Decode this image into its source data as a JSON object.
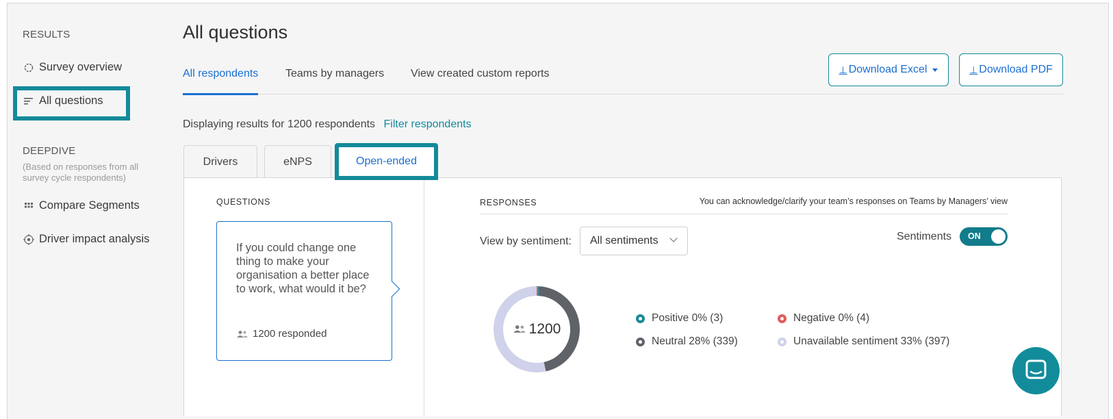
{
  "sidebar": {
    "results_heading": "RESULTS",
    "items": [
      {
        "label": "Survey overview",
        "icon": "circle-icon"
      },
      {
        "label": "All questions",
        "icon": "list-icon"
      }
    ],
    "deepdive_heading": "DEEPDIVE",
    "deepdive_note": "(Based on responses from all survey cycle respondents)",
    "deepdive_items": [
      {
        "label": "Compare Segments",
        "icon": "grid-icon"
      },
      {
        "label": "Driver impact analysis",
        "icon": "target-icon"
      }
    ]
  },
  "header": {
    "title": "All questions",
    "tabs": [
      {
        "label": "All respondents",
        "active": true
      },
      {
        "label": "Teams by managers",
        "active": false
      },
      {
        "label": "View created custom reports",
        "active": false
      }
    ],
    "download_excel": "Download Excel",
    "download_pdf": "Download PDF",
    "download_glyph": "⊥"
  },
  "filter": {
    "text": "Displaying results for 1200 respondents",
    "link": "Filter respondents"
  },
  "subtabs": [
    {
      "label": "Drivers"
    },
    {
      "label": "eNPS"
    },
    {
      "label": "Open-ended",
      "active": true
    }
  ],
  "questions": {
    "heading": "QUESTIONS",
    "card_text": "If you could change one thing to make your organisation a better place to work, what would it be?",
    "card_responded": "1200 responded"
  },
  "responses": {
    "heading": "RESPONSES",
    "note": "You can acknowledge/clarify your team’s responses on Teams by Managers’ view",
    "view_by_label": "View by sentiment:",
    "select_value": "All sentiments",
    "sentiments_label": "Sentiments",
    "toggle_label": "ON",
    "total": "1200",
    "legend": [
      {
        "label": "Positive 0% (3)",
        "color": "#1a8a99"
      },
      {
        "label": "Negative 0% (4)",
        "color": "#e25c5c"
      },
      {
        "label": "Neutral 28% (339)",
        "color": "#5f6368"
      },
      {
        "label": "Unavailable sentiment 33% (397)",
        "color": "#cfd2ea"
      }
    ],
    "donut": {
      "positive": 3,
      "negative": 4,
      "neutral": 339,
      "unavailable": 397
    }
  },
  "colors": {
    "accent": "#138a9a",
    "link_blue": "#1b6fd1"
  }
}
